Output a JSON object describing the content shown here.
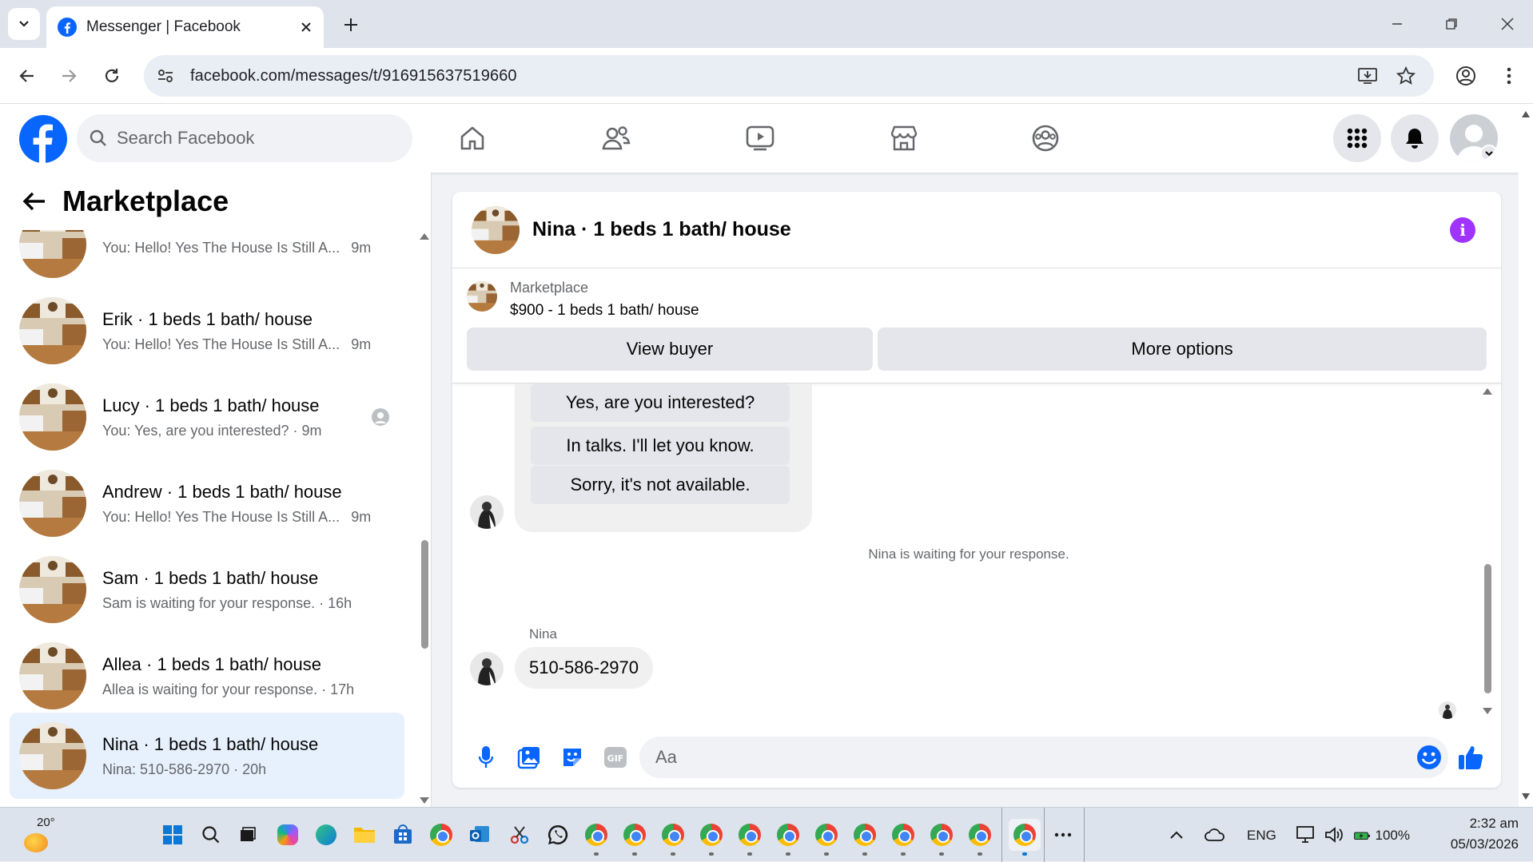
{
  "browser": {
    "tab_title": "Messenger | Facebook",
    "url": "facebook.com/messages/t/916915637519660"
  },
  "fb": {
    "search_placeholder": "Search Facebook"
  },
  "left_panel": {
    "title": "Marketplace",
    "conversations": [
      {
        "name": "",
        "preview": "You: Hello! Yes The House Is Still A...",
        "time": "9m"
      },
      {
        "name": "Erik · 1 beds 1 bath/ house",
        "preview": "You: Hello! Yes The House Is Still A...",
        "time": "9m"
      },
      {
        "name": "Lucy · 1 beds 1 bath/ house",
        "preview": "You: Yes, are you interested?",
        "time": "9m"
      },
      {
        "name": "Andrew · 1 beds 1 bath/ house",
        "preview": "You: Hello! Yes The House Is Still A...",
        "time": "9m"
      },
      {
        "name": "Sam · 1 beds 1 bath/ house",
        "preview": "Sam is waiting for your response.",
        "time": "16h"
      },
      {
        "name": "Allea · 1 beds 1 bath/ house",
        "preview": "Allea is waiting for your response.",
        "time": "17h"
      },
      {
        "name": "Nina · 1 beds 1 bath/ house",
        "preview": "Nina: 510-586-2970",
        "time": "20h"
      }
    ]
  },
  "chat": {
    "title": "Nina · 1 beds 1 bath/ house",
    "listing_category": "Marketplace",
    "listing_title": "$900 - 1 beds 1 bath/ house",
    "view_buyer": "View buyer",
    "more_options": "More options",
    "quick_replies": [
      "Yes, are you interested?",
      "In talks. I'll let you know.",
      "Sorry, it's not available."
    ],
    "system_message": "Nina is waiting for your response.",
    "sender_name": "Nina",
    "last_message": "510-586-2970",
    "composer_placeholder": "Aa"
  },
  "taskbar": {
    "weather_temp": "20°",
    "lang": "ENG",
    "battery": "100%",
    "time": "2:32 am",
    "date": "05/03/2026"
  },
  "colors": {
    "fb_blue": "#0866ff",
    "info_purple": "#a033ff",
    "selected_bg": "#e7f1fd"
  }
}
